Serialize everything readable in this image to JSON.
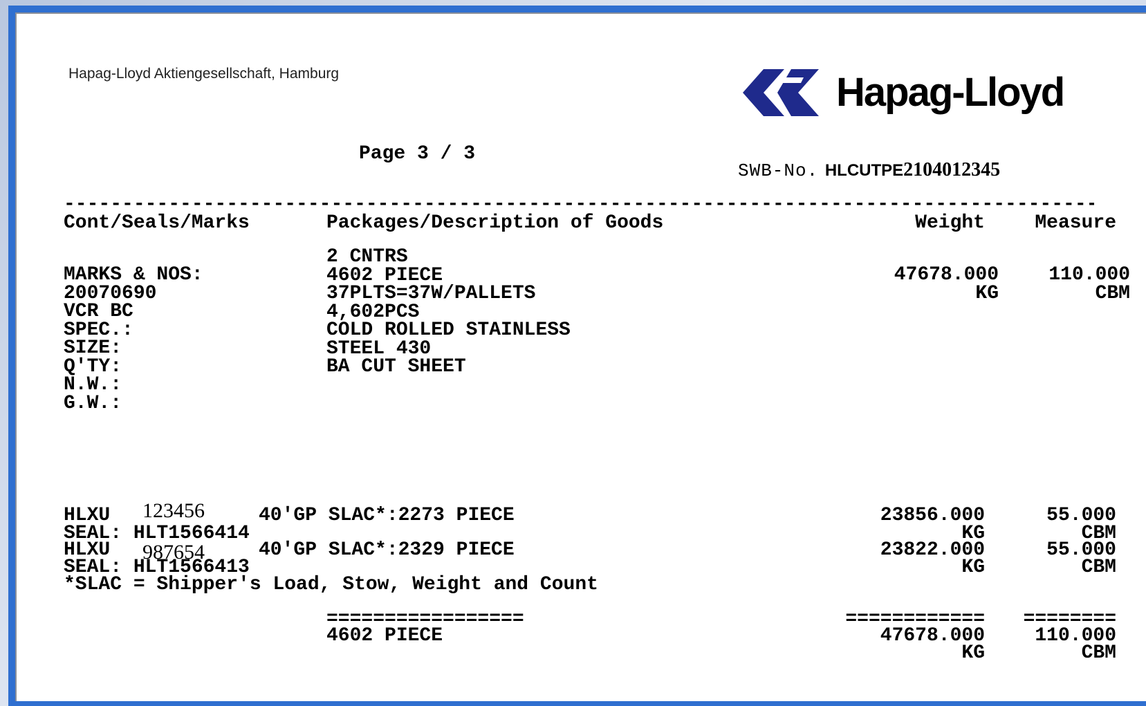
{
  "header": {
    "company": "Hapag-Lloyd Aktiengesellschaft, Hamburg",
    "logo_text": "Hapag-Lloyd",
    "page": "Page 3 / 3",
    "swb_label": "SWB-No.",
    "swb_prefix": "HLCUTPE",
    "swb_number": "2104012345"
  },
  "table": {
    "rule": "------------------------------------------------------------------------------------------------",
    "col_marks": "Cont/Seals/Marks",
    "col_description": "Packages/Description of Goods",
    "col_weight": "Weight",
    "col_measure": "Measure"
  },
  "marks": [
    "MARKS & NOS:",
    "20070690",
    "VCR BC",
    "SPEC.:",
    "SIZE:",
    "Q'TY:",
    "N.W.:",
    "G.W.:"
  ],
  "description": [
    "2 CNTRS",
    "4602 PIECE",
    "37PLTS=37W/PALLETS",
    "4,602PCS",
    "COLD ROLLED STAINLESS",
    "STEEL 430",
    "BA CUT SHEET"
  ],
  "totals_top": {
    "weight": "47678.000",
    "weight_unit": "KG",
    "measure": "110.000",
    "measure_unit": "CBM"
  },
  "containers": [
    {
      "prefix": "HLXU",
      "number": "123456",
      "desc": "40'GP SLAC*:2273 PIECE",
      "seal": "SEAL: HLT1566414",
      "weight": "23856.000",
      "weight_unit": "KG",
      "measure": "55.000",
      "measure_unit": "CBM"
    },
    {
      "prefix": "HLXU",
      "number": "987654",
      "desc": "40'GP SLAC*:2329 PIECE",
      "seal": "SEAL: HLT1566413",
      "weight": "23822.000",
      "weight_unit": "KG",
      "measure": "55.000",
      "measure_unit": "CBM"
    }
  ],
  "footnote": "*SLAC = Shipper's Load, Stow, Weight and Count",
  "summary": {
    "rule_desc": "=================",
    "rule_weight": "============",
    "rule_measure": "========",
    "pieces": "4602 PIECE",
    "weight": "47678.000",
    "weight_unit": "KG",
    "measure": "110.000",
    "measure_unit": "CBM"
  },
  "colors": {
    "logo_blue": "#1f2a8c",
    "frame_blue": "#2f6fd0"
  }
}
